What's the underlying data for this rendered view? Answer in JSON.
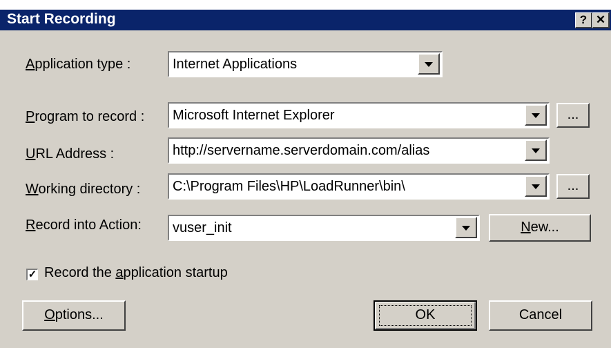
{
  "dialog": {
    "title": "Start Recording",
    "help_label": "?",
    "close_label": "✕"
  },
  "application_type": {
    "label_prefix": "",
    "label_key": "A",
    "label_rest": "pplication type :",
    "value": "Internet Applications"
  },
  "program_to_record": {
    "label_key": "P",
    "label_rest": "rogram to record :",
    "value": "Microsoft Internet Explorer",
    "browse_label": "..."
  },
  "url_address": {
    "label_key": "U",
    "label_rest": "RL Address :",
    "value": "http://servername.serverdomain.com/alias"
  },
  "working_directory": {
    "label_key": "W",
    "label_rest": "orking directory :",
    "value": "C:\\Program Files\\HP\\LoadRunner\\bin\\",
    "browse_label": "..."
  },
  "record_into_action": {
    "label_key": "R",
    "label_rest": "ecord into Action:",
    "value": "vuser_init",
    "new_key": "N",
    "new_rest": "ew..."
  },
  "startup_checkbox": {
    "checked": true,
    "mark": "✓",
    "label_pre": "Record the ",
    "label_key": "a",
    "label_rest": "pplication startup"
  },
  "buttons": {
    "options_key": "O",
    "options_rest": "ptions...",
    "ok_label": "OK",
    "cancel_label": "Cancel"
  }
}
